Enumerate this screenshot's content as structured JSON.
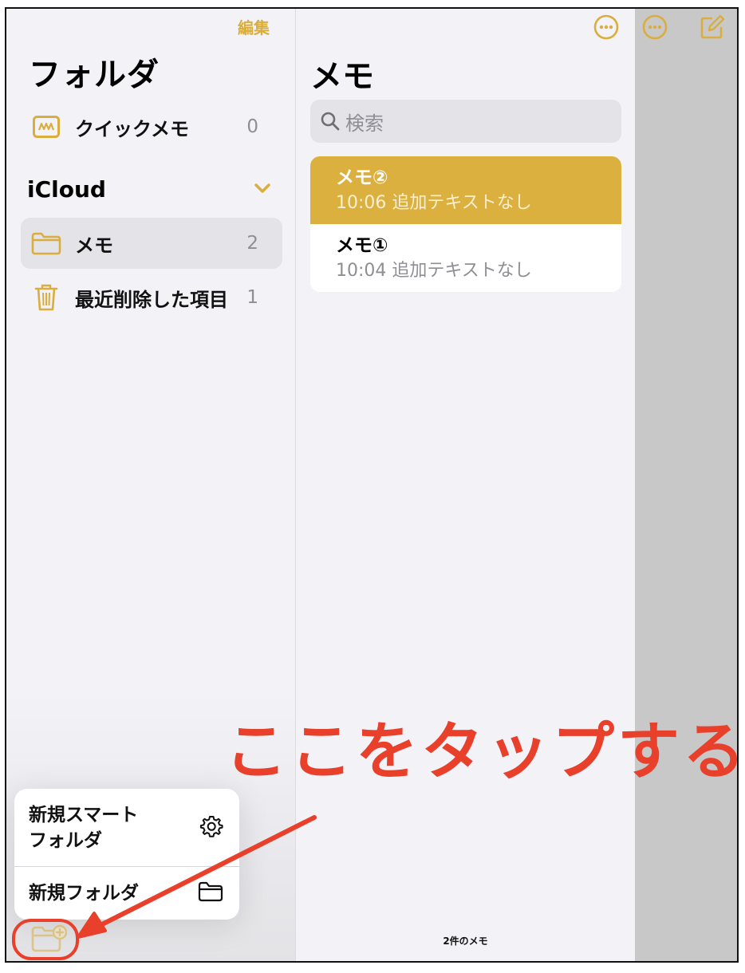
{
  "colors": {
    "accent": "#d9ae3e",
    "selected_note": "#dbb03f",
    "annotation": "#e8402b",
    "sidebar_bg": "#f2f2f7",
    "editor_bg": "#c8c8c8"
  },
  "sidebar": {
    "edit_label": "編集",
    "title": "フォルダ",
    "quick_note": {
      "icon": "quick-note-icon",
      "label": "クイックメモ",
      "count": "0"
    },
    "section": {
      "label": "iCloud",
      "icon": "chevron-down-icon"
    },
    "folders": [
      {
        "icon": "folder-icon",
        "label": "メモ",
        "count": "2",
        "selected": true
      },
      {
        "icon": "trash-icon",
        "label": "最近削除した項目",
        "count": "1",
        "selected": false
      }
    ]
  },
  "popup_menu": {
    "items": [
      {
        "label": "新規スマート\nフォルダ",
        "icon": "gear-icon"
      },
      {
        "label": "新規フォルダ",
        "icon": "folder-icon"
      }
    ]
  },
  "toolbar": {
    "new_folder_icon": "new-folder-icon",
    "more_icon": "ellipsis-circle-icon",
    "compose_icon": "compose-icon"
  },
  "note_list": {
    "title": "メモ",
    "search_placeholder": "検索",
    "notes": [
      {
        "title": "メモ②",
        "time": "10:06",
        "preview": "追加テキストなし",
        "selected": true
      },
      {
        "title": "メモ①",
        "time": "10:04",
        "preview": "追加テキストなし",
        "selected": false
      }
    ],
    "count_label": "2件のメモ"
  },
  "annotation": {
    "text": "ここをタップする"
  }
}
